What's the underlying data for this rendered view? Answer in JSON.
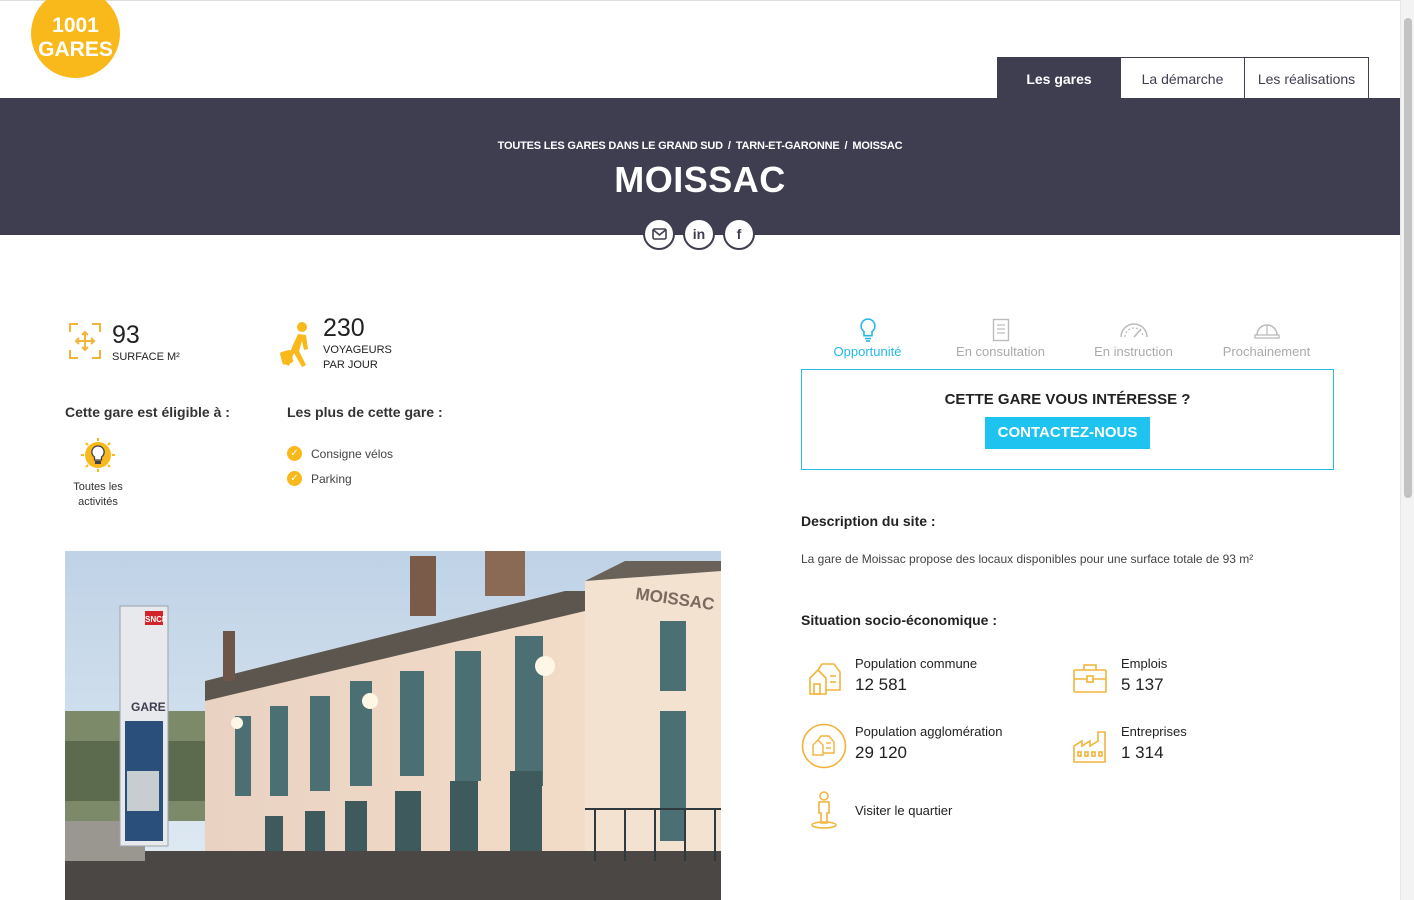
{
  "logo": {
    "line1": "1001",
    "line2": "GARES"
  },
  "nav": {
    "tabs": [
      {
        "label": "Les gares",
        "active": true
      },
      {
        "label": "La démarche",
        "active": false
      },
      {
        "label": "Les réalisations",
        "active": false
      }
    ]
  },
  "breadcrumb": {
    "items": [
      "TOUTES LES GARES DANS LE GRAND SUD",
      "TARN-ET-GARONNE",
      "MOISSAC"
    ],
    "separator": "/"
  },
  "page_title": "MOISSAC",
  "share": {
    "icons": [
      "mail-icon",
      "linkedin-icon",
      "facebook-icon"
    ],
    "linkedin_text": "in",
    "facebook_text": "f"
  },
  "stats": {
    "surface": {
      "value": "93",
      "label": "SURFACE M²"
    },
    "voyageurs": {
      "value": "230",
      "label_line1": "VOYAGEURS",
      "label_line2": "PAR JOUR"
    }
  },
  "eligible": {
    "heading": "Cette gare est éligible à :",
    "item_line1": "Toutes les",
    "item_line2": "activités"
  },
  "plus": {
    "heading": "Les plus de cette gare :",
    "items": [
      "Consigne vélos",
      "Parking"
    ]
  },
  "photo": {
    "sign_brand": "SNCF",
    "sign_text": "GARE",
    "building_text": "MOISSAC"
  },
  "status_steps": [
    {
      "label": "Opportunité",
      "active": true
    },
    {
      "label": "En consultation",
      "active": false
    },
    {
      "label": "En instruction",
      "active": false
    },
    {
      "label": "Prochainement",
      "active": false
    }
  ],
  "cta": {
    "title": "CETTE GARE VOUS INTÉRESSE ?",
    "button": "CONTACTEZ-NOUS"
  },
  "description": {
    "heading": "Description du site :",
    "text": "La gare de Moissac propose des locaux disponibles pour une surface totale de 93 m²"
  },
  "socio": {
    "heading": "Situation socio-économique :",
    "population_commune": {
      "label": "Population commune",
      "value": "12 581"
    },
    "emplois": {
      "label": "Emplois",
      "value": "5 137"
    },
    "population_agglo": {
      "label": "Population agglomération",
      "value": "29 120"
    },
    "entreprises": {
      "label": "Entreprises",
      "value": "1 314"
    },
    "visit": {
      "label": "Visiter le quartier"
    }
  },
  "colors": {
    "brand_yellow": "#f9b91b",
    "banner": "#3f3e50",
    "accent_blue": "#26b9e6",
    "button_blue": "#1ec3f0",
    "icon_gold": "#f2b43a"
  }
}
